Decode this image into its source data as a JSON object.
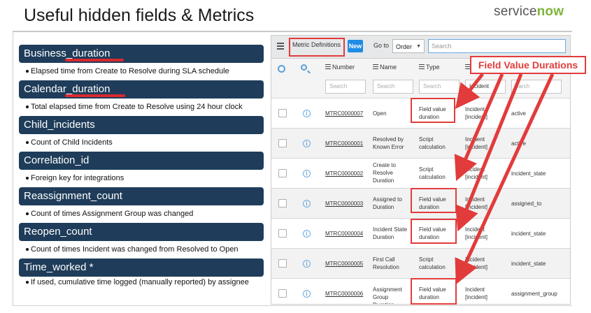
{
  "slide": {
    "title": "Useful hidden fields & Metrics",
    "brand_prefix": "service",
    "brand_suffix": "now"
  },
  "fields": [
    {
      "name": "Business_duration",
      "desc": "Elapsed time from Create to Resolve during SLA schedule"
    },
    {
      "name": "Calendar_duration",
      "desc": "Total elapsed time from Create to Resolve using 24 hour clock"
    },
    {
      "name": "Child_incidents",
      "desc": "Count of Child Incidents"
    },
    {
      "name": "Correlation_id",
      "desc": "Foreign key for integrations"
    },
    {
      "name": "Reassignment_count",
      "desc": "Count of times Assignment Group was changed"
    },
    {
      "name": "Reopen_count",
      "desc": "Count of times Incident was changed from Resolved to Open"
    },
    {
      "name": "Time_worked *",
      "desc": "If used, cumulative time logged (manually reported) by assignee"
    }
  ],
  "toolbar": {
    "list_title": "Metric Definitions",
    "new_label": "New",
    "goto_label": "Go to",
    "goto_select": "Order",
    "search_placeholder": "Search"
  },
  "columns": {
    "number": "Number",
    "name": "Name",
    "type": "Type",
    "table": "",
    "field": ""
  },
  "filters": {
    "number": "Search",
    "name": "Search",
    "type": "Search",
    "table": "Incident",
    "field": "earch"
  },
  "rows": [
    {
      "number": "MTRC0000007",
      "name": "Open",
      "type": "Field value duration",
      "table": "Incident [incident]",
      "field": "active"
    },
    {
      "number": "MTRC0000001",
      "name": "Resolved by Known Error",
      "type": "Script calculation",
      "table": "Incident [incident]",
      "field": "active"
    },
    {
      "number": "MTRC0000002",
      "name": "Create to Resolve Duration",
      "type": "Script calculation",
      "table": "Incident [incident]",
      "field": "incident_state"
    },
    {
      "number": "MTRC0000003",
      "name": "Assigned to Duration",
      "type": "Field value duration",
      "table": "Incident [incident]",
      "field": "assigned_to"
    },
    {
      "number": "MTRC0000004",
      "name": "Incident State Duration",
      "type": "Field value duration",
      "table": "Incident [incident]",
      "field": "incident_state"
    },
    {
      "number": "MTRC0000005",
      "name": "First Call Resolution",
      "type": "Script calculation",
      "table": "Incident [incident]",
      "field": "incident_state"
    },
    {
      "number": "MTRC0000006",
      "name": "Assignment Group Duration",
      "type": "Field value duration",
      "table": "Incident [incident]",
      "field": "assignment_group"
    }
  ],
  "callout": {
    "label": "Field Value Durations"
  },
  "colors": {
    "pill": "#1f3d5a",
    "highlight": "#e23b3b",
    "new_button": "#1f8ce6",
    "brand_green": "#7fb53a"
  }
}
